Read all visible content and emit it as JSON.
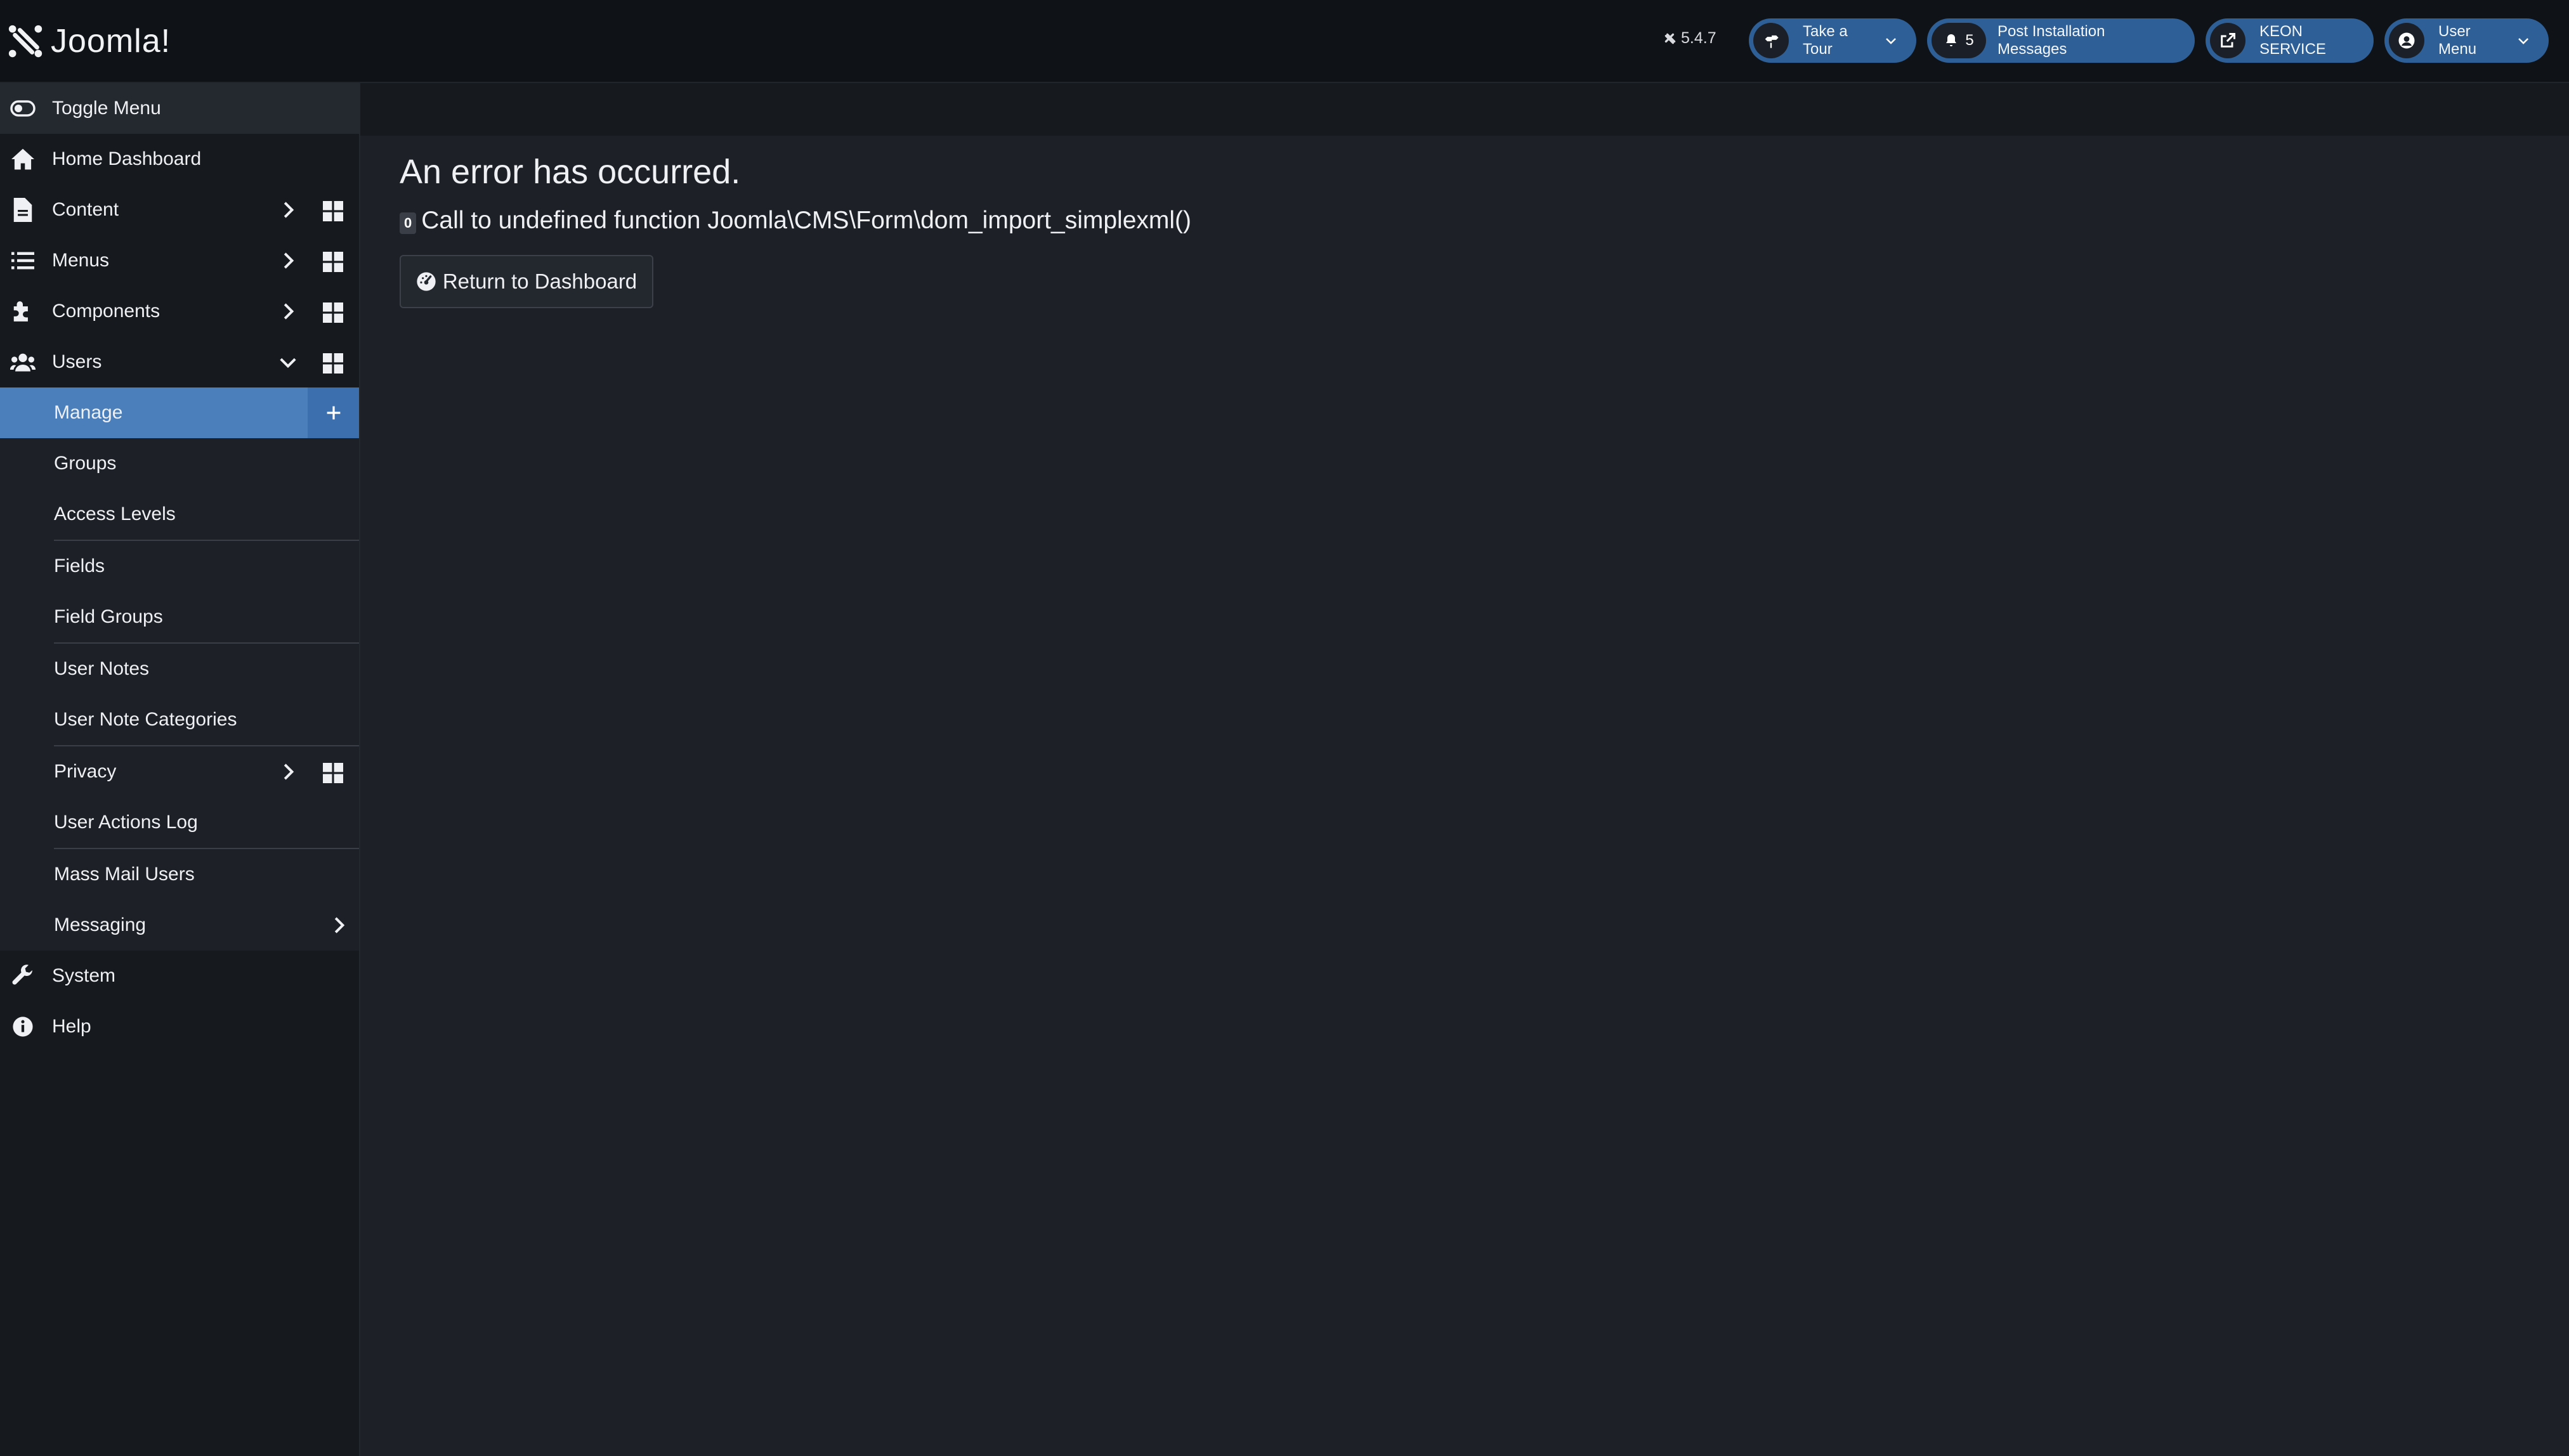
{
  "header": {
    "logo_text": "Joomla!",
    "version": "5.4.7",
    "buttons": {
      "tour": "Take a Tour",
      "notifications_count": "5",
      "post_install": "Post Installation Messages",
      "site": "KEON SERVICE",
      "user_menu": "User Menu"
    }
  },
  "sidebar": {
    "toggle": "Toggle Menu",
    "items": [
      {
        "label": "Home Dashboard",
        "icon": "home-icon"
      },
      {
        "label": "Content",
        "icon": "file-icon"
      },
      {
        "label": "Menus",
        "icon": "list-icon"
      },
      {
        "label": "Components",
        "icon": "puzzle-icon"
      },
      {
        "label": "Users",
        "icon": "users-icon"
      }
    ],
    "users_sub": [
      "Manage",
      "Groups",
      "Access Levels",
      "Fields",
      "Field Groups",
      "User Notes",
      "User Note Categories",
      "Privacy",
      "User Actions Log",
      "Mass Mail Users",
      "Messaging"
    ],
    "bottom_items": [
      {
        "label": "System",
        "icon": "wrench-icon"
      },
      {
        "label": "Help",
        "icon": "info-icon"
      }
    ]
  },
  "main": {
    "error_title": "An error has occurred.",
    "error_code": "0",
    "error_message": "Call to undefined function Joomla\\CMS\\Form\\dom_import_simplexml()",
    "return_button": "Return to Dashboard"
  },
  "colors": {
    "accent": "#4a7fbb",
    "header_button": "#2e5f96",
    "background": "#1d2026",
    "sidebar": "#16191e"
  }
}
